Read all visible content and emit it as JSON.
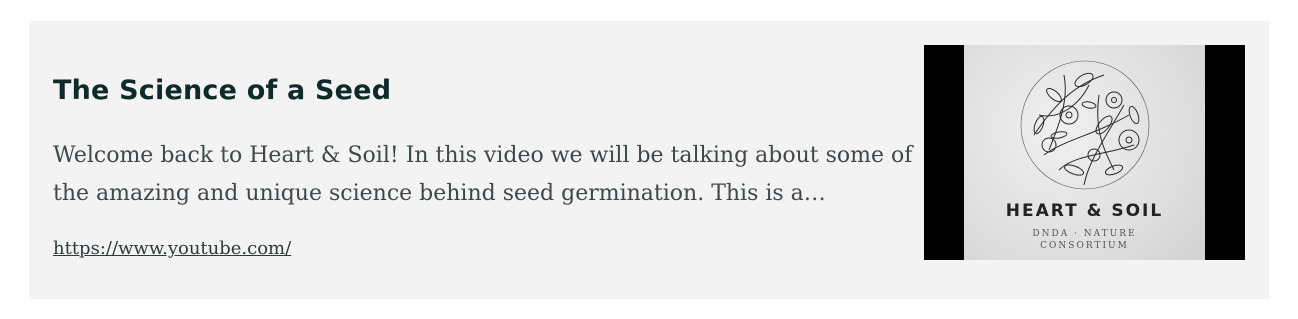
{
  "card": {
    "title": "The Science of a Seed",
    "description": "Welcome back to Heart & Soil! In this video we will be talking about some of the amazing and unique science behind seed germination. This is a…",
    "url": "https://www.youtube.com/"
  },
  "thumbnail": {
    "brand_name": "HEART & SOIL",
    "brand_line1": "DNDA · NATURE",
    "brand_line2": "CONSORTIUM",
    "background": "#000000"
  },
  "colors": {
    "card_bg": "#f3f3f3",
    "title": "#0f2a2a",
    "text": "#3f4848"
  }
}
